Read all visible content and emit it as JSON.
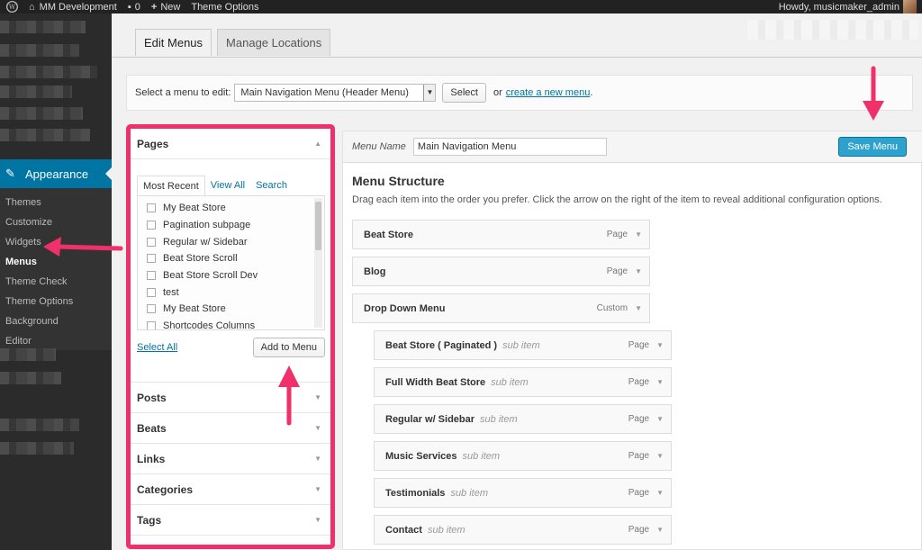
{
  "adminbar": {
    "site_name": "MM Development",
    "comments_count": "0",
    "new_label": "New",
    "theme_options": "Theme Options",
    "howdy": "Howdy, musicmaker_admin"
  },
  "sidebar": {
    "appearance_label": "Appearance",
    "submenu": [
      "Themes",
      "Customize",
      "Widgets",
      "Menus",
      "Theme Check",
      "Theme Options",
      "Background",
      "Editor"
    ]
  },
  "tabs": {
    "edit_menus": "Edit Menus",
    "manage_locations": "Manage Locations"
  },
  "select_bar": {
    "label": "Select a menu to edit:",
    "selected": "Main Navigation Menu (Header Menu)",
    "select_button": "Select",
    "or_text": "or",
    "create_link": "create a new menu",
    "period": "."
  },
  "pages_panel": {
    "title": "Pages",
    "subtabs": [
      "Most Recent",
      "View All",
      "Search"
    ],
    "items": [
      "My Beat Store",
      "Pagination subpage",
      "Regular w/ Sidebar",
      "Beat Store Scroll",
      "Beat Store Scroll Dev",
      "test",
      "My Beat Store",
      "Shortcodes Columns"
    ],
    "select_all": "Select All",
    "add_to_menu": "Add to Menu"
  },
  "accordion": [
    "Posts",
    "Beats",
    "Links",
    "Categories",
    "Tags"
  ],
  "menu_editor": {
    "name_label": "Menu Name",
    "name_value": "Main Navigation Menu",
    "save_button": "Save Menu",
    "structure_title": "Menu Structure",
    "structure_desc": "Drag each item into the order you prefer. Click the arrow on the right of the item to reveal additional configuration options.",
    "items": [
      {
        "title": "Beat Store",
        "type": "Page",
        "sub": ""
      },
      {
        "title": "Blog",
        "type": "Page",
        "sub": ""
      },
      {
        "title": "Drop Down Menu",
        "type": "Custom",
        "sub": ""
      },
      {
        "title": "Beat Store ( Paginated )",
        "type": "Page",
        "sub": "sub item"
      },
      {
        "title": "Full Width Beat Store",
        "type": "Page",
        "sub": "sub item"
      },
      {
        "title": "Regular w/ Sidebar",
        "type": "Page",
        "sub": "sub item"
      },
      {
        "title": "Music Services",
        "type": "Page",
        "sub": "sub item"
      },
      {
        "title": "Testimonials",
        "type": "Page",
        "sub": "sub item"
      },
      {
        "title": "Contact",
        "type": "Page",
        "sub": "sub item"
      }
    ]
  },
  "colors": {
    "accent": "#0074a2",
    "highlight": "#f0306b",
    "save_button": "#2ea2cc"
  }
}
